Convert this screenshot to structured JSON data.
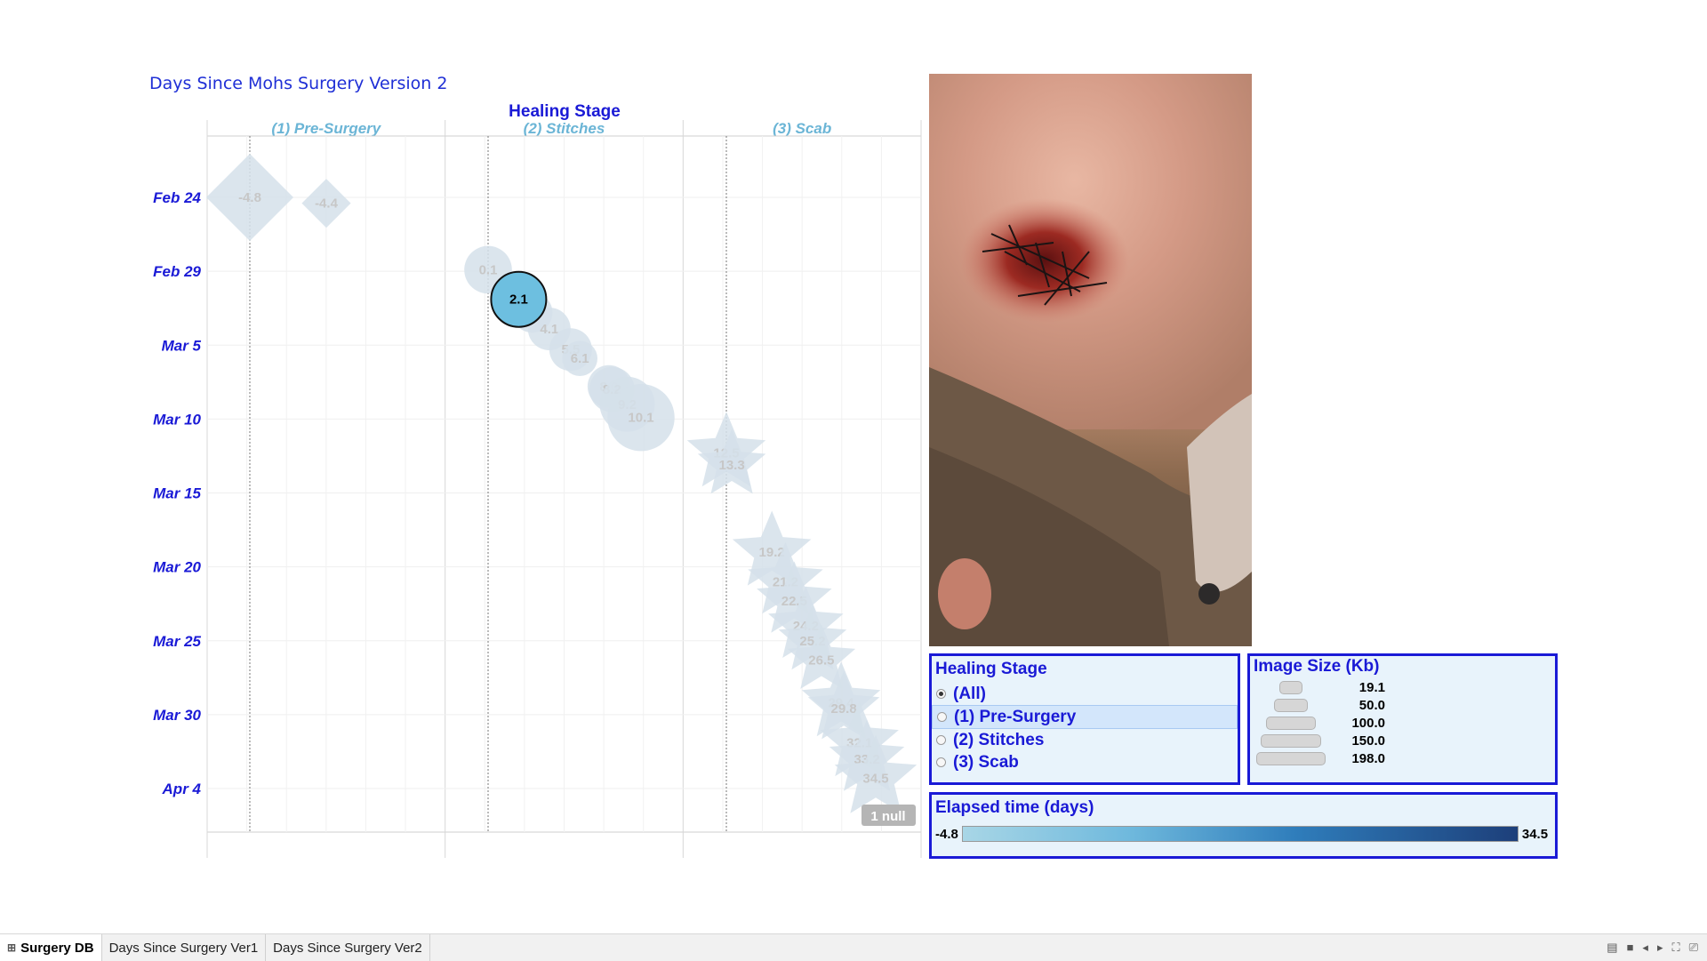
{
  "sheet_title": "Days Since Mohs Surgery Version 2",
  "chart_data": {
    "type": "scatter",
    "column_header_title": "Healing Stage",
    "columns": [
      "(1) Pre-Surgery",
      "(2) Stitches",
      "(3) Scab"
    ],
    "y_tick_labels": [
      "Feb 24",
      "Feb 29",
      "Mar 5",
      "Mar 10",
      "Mar 15",
      "Mar 20",
      "Mar 25",
      "Mar 30",
      "Apr 4"
    ],
    "y_axis": "date",
    "y_start": "Feb 24",
    "y_end": "Apr 4",
    "size_legend": "Image Size (Kb)",
    "color_legend": "Elapsed time (days)",
    "points": [
      {
        "stage": "(1) Pre-Surgery",
        "elapsed": "-4.8",
        "shape": "diamond",
        "size": 198,
        "highlight": false
      },
      {
        "stage": "(1) Pre-Surgery",
        "elapsed": "-4.4",
        "shape": "diamond",
        "size": 80,
        "highlight": false
      },
      {
        "stage": "(2) Stitches",
        "elapsed": "0.1",
        "shape": "circle",
        "size": 120,
        "highlight": false
      },
      {
        "stage": "(2) Stitches",
        "elapsed": "2.1",
        "shape": "circle",
        "size": 150,
        "highlight": true
      },
      {
        "stage": "(2) Stitches",
        "elapsed": "3",
        "shape": "circle",
        "size": 90,
        "highlight": false
      },
      {
        "stage": "(2) Stitches",
        "elapsed": "4.1",
        "shape": "circle",
        "size": 100,
        "highlight": false
      },
      {
        "stage": "(2) Stitches",
        "elapsed": "5.5",
        "shape": "circle",
        "size": 100,
        "highlight": false
      },
      {
        "stage": "(2) Stitches",
        "elapsed": "6.1",
        "shape": "circle",
        "size": 70,
        "highlight": false
      },
      {
        "stage": "(2) Stitches",
        "elapsed": "8.0",
        "shape": "circle",
        "size": 100,
        "highlight": false
      },
      {
        "stage": "(2) Stitches",
        "elapsed": "8.2",
        "shape": "circle",
        "size": 110,
        "highlight": false
      },
      {
        "stage": "(2) Stitches",
        "elapsed": "9.2",
        "shape": "circle",
        "size": 150,
        "highlight": false
      },
      {
        "stage": "(2) Stitches",
        "elapsed": "10.1",
        "shape": "circle",
        "size": 198,
        "highlight": false
      },
      {
        "stage": "(3) Scab",
        "elapsed": "12.5",
        "shape": "star",
        "size": 150,
        "highlight": false
      },
      {
        "stage": "(3) Scab",
        "elapsed": "13.3",
        "shape": "star",
        "size": 120,
        "highlight": false
      },
      {
        "stage": "(3) Scab",
        "elapsed": "19.2",
        "shape": "star",
        "size": 150,
        "highlight": false
      },
      {
        "stage": "(3) Scab",
        "elapsed": "21.2",
        "shape": "star",
        "size": 140,
        "highlight": false
      },
      {
        "stage": "(3) Scab",
        "elapsed": "22.5",
        "shape": "star",
        "size": 140,
        "highlight": false
      },
      {
        "stage": "(3) Scab",
        "elapsed": "24.2",
        "shape": "star",
        "size": 140,
        "highlight": false
      },
      {
        "stage": "(3) Scab",
        "elapsed": "25.2",
        "shape": "star",
        "size": 120,
        "highlight": false
      },
      {
        "stage": "(3) Scab",
        "elapsed": "26.5",
        "shape": "star",
        "size": 120,
        "highlight": false
      },
      {
        "stage": "(3) Scab",
        "elapsed": "29.4",
        "shape": "star",
        "size": 150,
        "highlight": false
      },
      {
        "stage": "(3) Scab",
        "elapsed": "29.8",
        "shape": "star",
        "size": 130,
        "highlight": false
      },
      {
        "stage": "(3) Scab",
        "elapsed": "32.1",
        "shape": "star",
        "size": 150,
        "highlight": false
      },
      {
        "stage": "(3) Scab",
        "elapsed": "33.2",
        "shape": "star",
        "size": 140,
        "highlight": false
      },
      {
        "stage": "(3) Scab",
        "elapsed": "34.5",
        "shape": "star",
        "size": 160,
        "highlight": false
      }
    ],
    "null_indicator": "1 null"
  },
  "filter_panel": {
    "title": "Healing Stage",
    "options": [
      {
        "label": "(All)",
        "selected": true
      },
      {
        "label": "(1) Pre-Surgery",
        "selected": false
      },
      {
        "label": "(2) Stitches",
        "selected": false
      },
      {
        "label": "(3) Scab",
        "selected": false
      }
    ]
  },
  "size_legend": {
    "title": "Image Size (Kb)",
    "items": [
      "19.1",
      "50.0",
      "100.0",
      "150.0",
      "198.0"
    ]
  },
  "color_legend": {
    "title": "Elapsed time (days)",
    "min_label": "-4.8",
    "max_label": "34.5"
  },
  "tabs": [
    {
      "label": "Surgery DB",
      "icon": "grid-icon",
      "active": true
    },
    {
      "label": "Days Since Surgery Ver1",
      "active": false
    },
    {
      "label": "Days Since Surgery Ver2",
      "active": false
    }
  ],
  "colors": {
    "accent": "#1a1ad6",
    "highlight_point": "#6dbfe0",
    "faded_point": "#d5e0ea",
    "column_header": "#6bb5d6"
  }
}
